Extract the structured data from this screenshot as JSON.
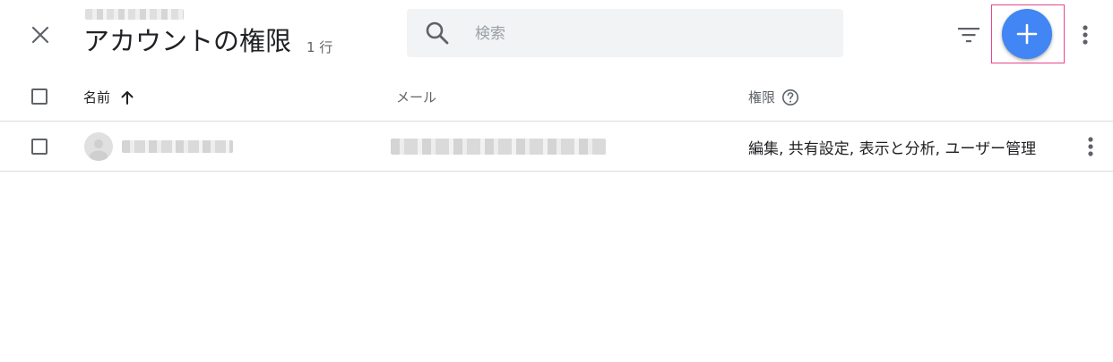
{
  "header": {
    "title": "アカウントの権限",
    "row_count": "1 行",
    "close_icon": "close-icon",
    "filter_icon": "filter-icon",
    "add_icon": "plus-icon",
    "more_icon": "more-vert-icon"
  },
  "search": {
    "placeholder": "検索",
    "value": ""
  },
  "table": {
    "columns": [
      {
        "label": "名前",
        "sort": "ascending"
      },
      {
        "label": "メール"
      },
      {
        "label": "権限",
        "help_icon": "help-icon"
      }
    ],
    "rows": [
      {
        "permissions": "編集, 共有設定, 表示と分析, ユーザー管理"
      }
    ]
  },
  "colors": {
    "accent": "#4285f4",
    "highlight": "#e5468a",
    "search_bg": "#f1f3f4",
    "divider": "#dadce0"
  }
}
